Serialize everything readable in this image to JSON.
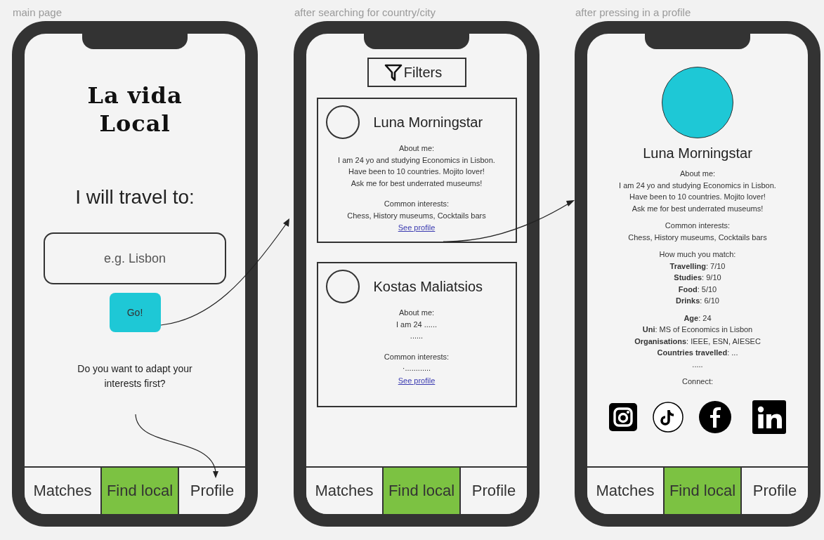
{
  "screens": [
    {
      "kind": "home",
      "caption": "main page",
      "title": "La vida Local",
      "prompt": "I will travel to:",
      "field": {
        "placeholder": "e.g. Lisbon"
      },
      "go_button": "Go!",
      "question": "Do you want to adapt your interests first?",
      "tabs": [
        {
          "label": "Matches",
          "selected": false
        },
        {
          "label": "Find local",
          "selected": true
        },
        {
          "label": "Profile",
          "selected": false
        }
      ]
    },
    {
      "kind": "results",
      "caption": "after searching for country/city",
      "filter_button": "Filters",
      "cards": [
        {
          "name": "Luna Morningstar",
          "about_label": "About me:",
          "about_lines": [
            "I am 24 yo and studying Economics in Lisbon.",
            "Have been to 10 countries. Mojito lover!",
            "Ask me for best underrated museums!"
          ],
          "interests_label": "Common interests:",
          "interests": "Chess, History museums, Cocktails bars",
          "link": "See profile"
        },
        {
          "name": "Kostas Maliatsios",
          "about_label": "About me:",
          "about_lines": [
            "I am 24 ......",
            "......"
          ],
          "interests_label": "Common interests:",
          "interests": "·............",
          "link": "See profile"
        }
      ],
      "tabs": [
        {
          "label": "Matches",
          "selected": false
        },
        {
          "label": "Find local",
          "selected": true
        },
        {
          "label": "Profile",
          "selected": false
        }
      ]
    },
    {
      "kind": "profile",
      "caption": "after pressing in a profile",
      "name": "Luna Morningstar",
      "sections": [
        {
          "lines": [
            "About me:",
            "I am 24 yo and studying Economics in Lisbon.",
            "Have been to 10 countries. Mojito lover!",
            "Ask me for best underrated museums!"
          ]
        },
        {
          "lines": [
            "Common interests:",
            "Chess, History museums, Cocktails bars"
          ]
        },
        {
          "lines": [
            "How much you match:",
            "**Travelling**: 7/10",
            "**Studies**: 9/10",
            "**Food**: 5/10",
            "**Drinks**: 6/10"
          ]
        },
        {
          "lines": [
            "**Age**: 24",
            "**Uni**: MS of Economics in Lisbon",
            "**Organisations**: IEEE, ESN, AIESEC",
            "**Countries travelled**: ...",
            "....."
          ]
        },
        {
          "lines": [
            "Connect:"
          ]
        }
      ],
      "tabs": [
        {
          "label": "Matches",
          "selected": false
        },
        {
          "label": "Find local",
          "selected": true
        },
        {
          "label": "Profile",
          "selected": false
        }
      ]
    }
  ]
}
